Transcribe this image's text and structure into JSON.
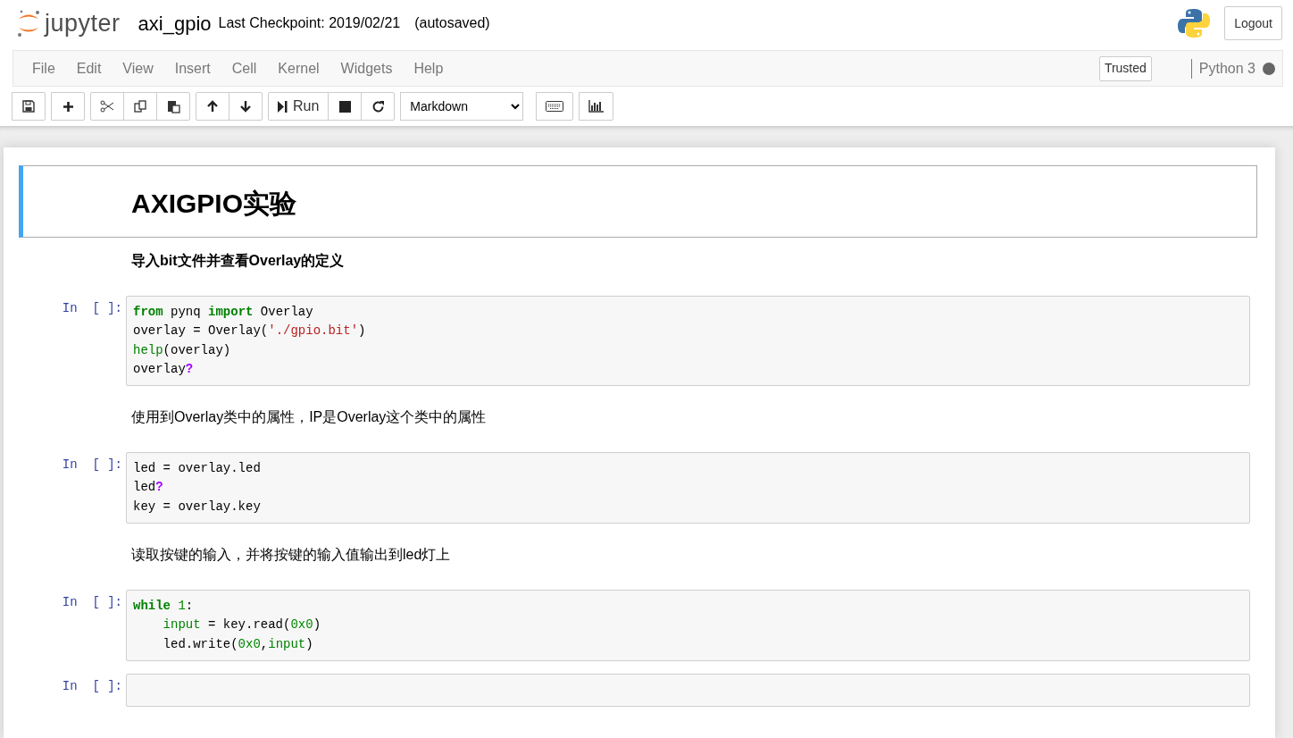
{
  "header": {
    "logo_text": "jupyter",
    "notebook_name": "axi_gpio",
    "checkpoint": "Last Checkpoint: 2019/02/21",
    "autosave": "(autosaved)",
    "logout": "Logout"
  },
  "menu": [
    "File",
    "Edit",
    "View",
    "Insert",
    "Cell",
    "Kernel",
    "Widgets",
    "Help"
  ],
  "trusted": "Trusted",
  "kernel": {
    "name": "Python 3",
    "busy": true
  },
  "toolbar": {
    "run_label": "Run",
    "cell_type": "Markdown"
  },
  "cells": [
    {
      "kind": "heading1",
      "selected": true,
      "text": "AXIGPIO实验"
    },
    {
      "kind": "heading4",
      "selected": false,
      "text": "导入bit文件并查看Overlay的定义"
    },
    {
      "kind": "code",
      "selected": false,
      "prompt": "In  [ ]:",
      "lines": [
        {
          "indented": false,
          "tokens": [
            {
              "kind": "kw",
              "text": "from"
            },
            {
              "kind": "plain",
              "text": " pynq "
            },
            {
              "kind": "kw",
              "text": "import"
            },
            {
              "kind": "plain",
              "text": " Overlay"
            }
          ]
        },
        {
          "indented": false,
          "tokens": [
            {
              "kind": "plain",
              "text": "overlay = Overlay("
            },
            {
              "kind": "str",
              "text": "'./gpio.bit'"
            },
            {
              "kind": "plain",
              "text": ")"
            }
          ]
        },
        {
          "indented": false,
          "tokens": [
            {
              "kind": "builtin",
              "text": "help"
            },
            {
              "kind": "plain",
              "text": "(overlay)"
            }
          ]
        },
        {
          "indented": false,
          "tokens": [
            {
              "kind": "plain",
              "text": "overlay"
            },
            {
              "kind": "op",
              "text": "?"
            }
          ]
        }
      ]
    },
    {
      "kind": "paragraph",
      "selected": false,
      "text": "使用到Overlay类中的属性，IP是Overlay这个类中的属性"
    },
    {
      "kind": "code",
      "selected": false,
      "prompt": "In  [ ]:",
      "lines": [
        {
          "indented": false,
          "tokens": [
            {
              "kind": "plain",
              "text": "led = overlay.led"
            }
          ]
        },
        {
          "indented": false,
          "tokens": [
            {
              "kind": "plain",
              "text": "led"
            },
            {
              "kind": "op",
              "text": "?"
            }
          ]
        },
        {
          "indented": false,
          "tokens": [
            {
              "kind": "plain",
              "text": "key = overlay.key"
            }
          ]
        }
      ]
    },
    {
      "kind": "paragraph",
      "selected": false,
      "text": "读取按键的输入，并将按键的输入值输出到led灯上"
    },
    {
      "kind": "code",
      "selected": false,
      "prompt": "In  [ ]:",
      "lines": [
        {
          "indented": false,
          "tokens": [
            {
              "kind": "kw",
              "text": "while"
            },
            {
              "kind": "num",
              "text": "1",
              "spaced": true
            },
            {
              "kind": "plain",
              "text": ":"
            }
          ]
        },
        {
          "indented": true,
          "tokens": [
            {
              "kind": "builtin",
              "text": "input"
            },
            {
              "kind": "plain",
              "text": " = key.read("
            },
            {
              "kind": "num",
              "text": "0x0"
            },
            {
              "kind": "plain",
              "text": ")"
            }
          ]
        },
        {
          "indented": true,
          "tokens": [
            {
              "kind": "plain",
              "text": "led.write("
            },
            {
              "kind": "num",
              "text": "0x0"
            },
            {
              "kind": "plain",
              "text": ","
            },
            {
              "kind": "builtin",
              "text": "input"
            },
            {
              "kind": "plain",
              "text": ")"
            }
          ]
        }
      ]
    },
    {
      "kind": "code",
      "selected": false,
      "prompt": "In  [ ]:"
    }
  ]
}
